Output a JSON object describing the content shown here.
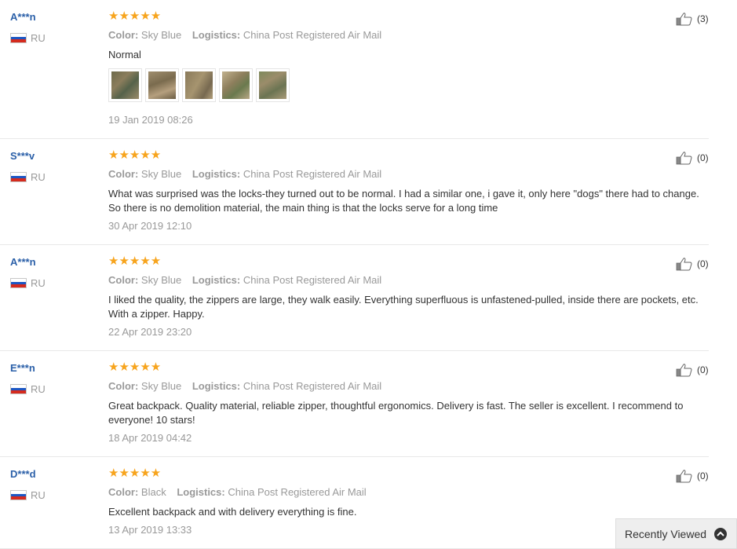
{
  "reviews": [
    {
      "user": "A***n",
      "country": "RU",
      "stars": "★★★★★",
      "color_label": "Color:",
      "color_value": "Sky Blue",
      "logistics_label": "Logistics:",
      "logistics_value": "China Post Registered Air Mail",
      "text": "Normal",
      "date": "19 Jan 2019 08:26",
      "helpful": "(3)"
    },
    {
      "user": "S***v",
      "country": "RU",
      "stars": "★★★★★",
      "color_label": "Color:",
      "color_value": "Sky Blue",
      "logistics_label": "Logistics:",
      "logistics_value": "China Post Registered Air Mail",
      "text": "What was surprised was the locks-they turned out to be normal. I had a similar one, i gave it, only here \"dogs\" there had to change. So there is no demolition material, the main thing is that the locks serve for a long time",
      "date": "30 Apr 2019 12:10",
      "helpful": "(0)"
    },
    {
      "user": "A***n",
      "country": "RU",
      "stars": "★★★★★",
      "color_label": "Color:",
      "color_value": "Sky Blue",
      "logistics_label": "Logistics:",
      "logistics_value": "China Post Registered Air Mail",
      "text": "I liked the quality, the zippers are large, they walk easily. Everything superfluous is unfastened-pulled, inside there are pockets, etc. With a zipper. Happy.",
      "date": "22 Apr 2019 23:20",
      "helpful": "(0)"
    },
    {
      "user": "E***n",
      "country": "RU",
      "stars": "★★★★★",
      "color_label": "Color:",
      "color_value": "Sky Blue",
      "logistics_label": "Logistics:",
      "logistics_value": "China Post Registered Air Mail",
      "text": "Great backpack. Quality material, reliable zipper, thoughtful ergonomics. Delivery is fast. The seller is excellent. I recommend to everyone! 10 stars!",
      "date": "18 Apr 2019 04:42",
      "helpful": "(0)"
    },
    {
      "user": "D***d",
      "country": "RU",
      "stars": "★★★★★",
      "color_label": "Color:",
      "color_value": "Black",
      "logistics_label": "Logistics:",
      "logistics_value": "China Post Registered Air Mail",
      "text": "Excellent backpack and with delivery everything is fine.",
      "date": "13 Apr 2019 13:33",
      "helpful": "(0)"
    }
  ],
  "rating_value": 5,
  "rating_max": 5,
  "icons": {
    "star": "star-icon",
    "thumb": "thumbs-up-icon",
    "flag": "russia-flag-icon",
    "up": "chevron-up-icon"
  },
  "colors": {
    "star": "#f7a41d",
    "username": "#2a5fa8",
    "muted": "#999999"
  },
  "recently_viewed": {
    "label": "Recently Viewed"
  }
}
